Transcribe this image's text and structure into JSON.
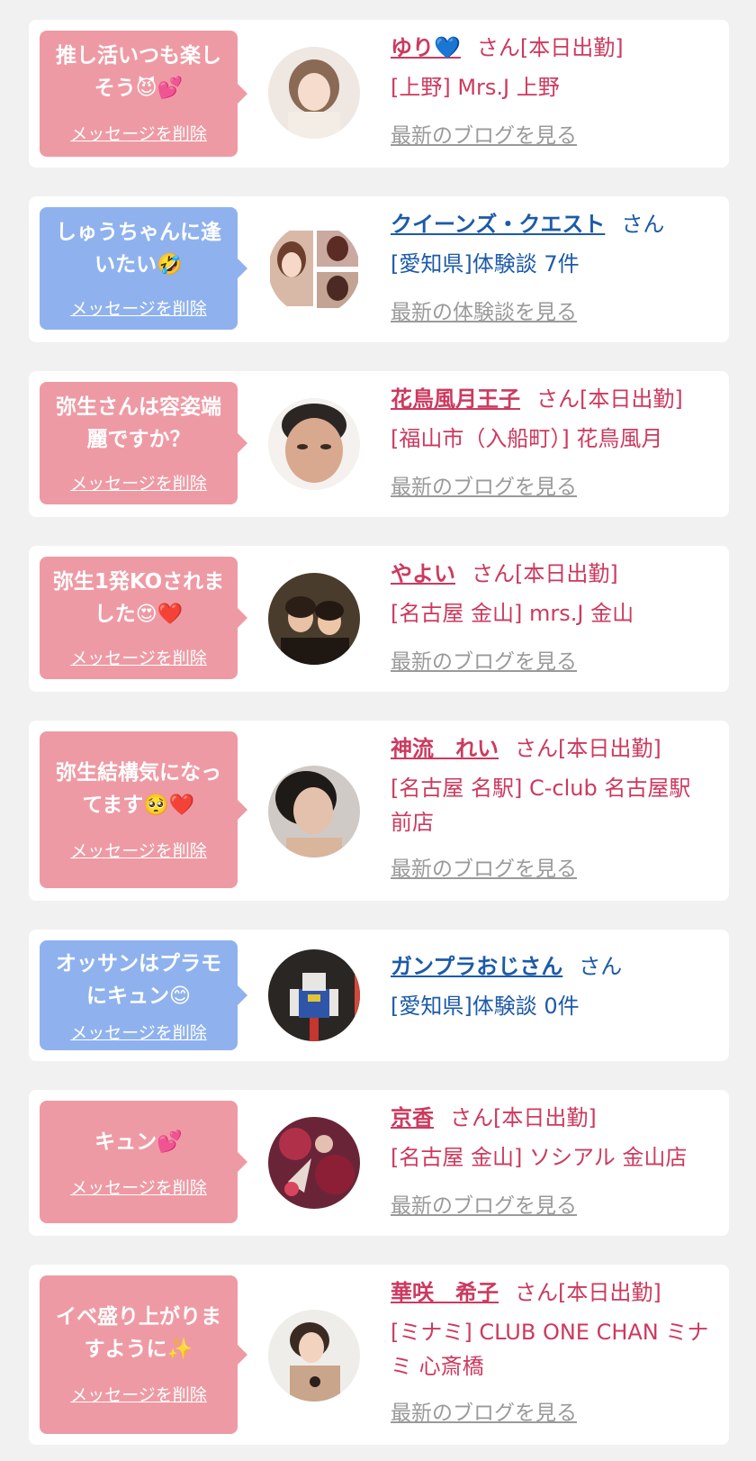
{
  "cards": [
    {
      "message": "推し活いつも楽しそう😈💕",
      "delete_label": "メッセージを削除",
      "name": "ゆり💙",
      "suffix": "さん[本日出勤]",
      "sub": "[上野] Mrs.J 上野",
      "link": "最新のブログを見る"
    },
    {
      "message": "しゅうちゃんに逢いたい🤣",
      "delete_label": "メッセージを削除",
      "name": "クイーンズ・クエスト",
      "suffix": "さん",
      "sub": "[愛知県]体験談 7件",
      "link": "最新の体験談を見る"
    },
    {
      "message": "弥生さんは容姿端麗ですか？",
      "delete_label": "メッセージを削除",
      "name": "花鳥風月王子",
      "suffix": "さん[本日出勤]",
      "sub": "[福山市（入船町）] 花鳥風月",
      "link": "最新のブログを見る"
    },
    {
      "message": "弥生1発KOされました😍❤️",
      "delete_label": "メッセージを削除",
      "name": "やよい",
      "suffix": "さん[本日出勤]",
      "sub": "[名古屋 金山] mrs.J 金山",
      "link": "最新のブログを見る"
    },
    {
      "message": "弥生結構気になってます🥺❤️",
      "delete_label": "メッセージを削除",
      "name": "神流　れい",
      "suffix": "さん[本日出勤]",
      "sub": "[名古屋 名駅] C-club 名古屋駅前店",
      "link": "最新のブログを見る"
    },
    {
      "message": "オッサンはプラモにキュン😊",
      "delete_label": "メッセージを削除",
      "name": "ガンプラおじさん",
      "suffix": "さん",
      "sub": "[愛知県]体験談 0件",
      "link": ""
    },
    {
      "message": "キュン💕",
      "delete_label": "メッセージを削除",
      "name": "京香",
      "suffix": "さん[本日出勤]",
      "sub": "[名古屋 金山] ソシアル 金山店",
      "link": "最新のブログを見る"
    },
    {
      "message": "イベ盛り上がりますように✨",
      "delete_label": "メッセージを削除",
      "name": "華咲　希子",
      "suffix": "さん[本日出勤]",
      "sub": "[ミナミ] CLUB ONE CHAN ミナミ 心斎橋",
      "link": "最新のブログを見る"
    }
  ],
  "colors": {
    "pink_bubble": "#ee9aa4",
    "blue_bubble": "#8fb2ee",
    "pink_text": "#cc3a5f",
    "blue_text": "#1d5aa8",
    "link_gray": "#9a9a9a"
  }
}
